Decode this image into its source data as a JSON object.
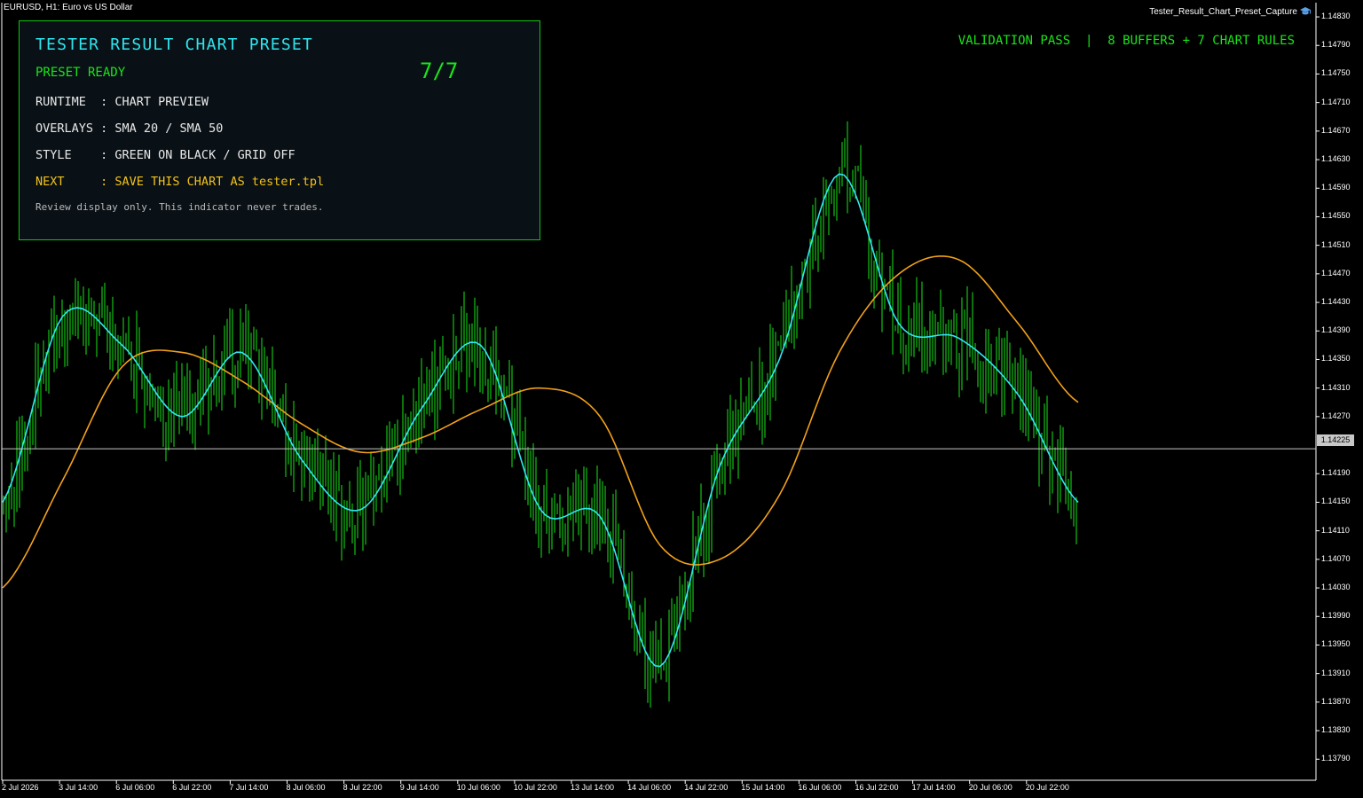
{
  "chart": {
    "title": "EURUSD, H1:  Euro vs US Dollar",
    "window_name": "Tester_Result_Chart_Preset_Capture",
    "hat_icon": "graduation-cap-icon",
    "current_price": "1.14225",
    "price_axis": [
      "1.14830",
      "1.14790",
      "1.14750",
      "1.14710",
      "1.14670",
      "1.14630",
      "1.14590",
      "1.14550",
      "1.14510",
      "1.14470",
      "1.14430",
      "1.14390",
      "1.14350",
      "1.14310",
      "1.14270",
      "1.14190",
      "1.14150",
      "1.14110",
      "1.14070",
      "1.14030",
      "1.13990",
      "1.13950",
      "1.13910",
      "1.13870",
      "1.13830",
      "1.13790"
    ],
    "time_axis": [
      "2 Jul 2026",
      "3 Jul 14:00",
      "6 Jul 06:00",
      "6 Jul 22:00",
      "7 Jul 14:00",
      "8 Jul 06:00",
      "8 Jul 22:00",
      "9 Jul 14:00",
      "10 Jul 06:00",
      "10 Jul 22:00",
      "13 Jul 14:00",
      "14 Jul 06:00",
      "14 Jul 22:00",
      "15 Jul 14:00",
      "16 Jul 06:00",
      "16 Jul 22:00",
      "17 Jul 14:00",
      "20 Jul 06:00",
      "20 Jul 22:00"
    ],
    "colors": {
      "background": "#000000",
      "candles": "#19e619",
      "sma_fast": "#33e6f2",
      "sma_slow": "#f2a11a",
      "bid_line": "#c8c8c8"
    }
  },
  "panel": {
    "title": "TESTER RESULT CHART PRESET",
    "status": "PRESET READY",
    "count": "7/7",
    "rows": [
      {
        "text": "RUNTIME  : CHART PREVIEW"
      },
      {
        "text": "OVERLAYS : SMA 20 / SMA 50"
      },
      {
        "text": "STYLE    : GREEN ON BLACK / GRID OFF"
      },
      {
        "text": "NEXT     : SAVE THIS CHART AS tester.tpl"
      }
    ],
    "footnote": "Review display only. This indicator never trades."
  },
  "banner": {
    "text": "VALIDATION PASS  |  8 BUFFERS + 7 CHART RULES"
  },
  "chart_data": {
    "type": "line",
    "xlabel": "",
    "ylabel": "",
    "ylim": [
      1.1376,
      1.1484
    ],
    "grid": false,
    "current_price": 1.14225,
    "x": [
      "2 Jul 2026",
      "3 Jul 14:00",
      "6 Jul 06:00",
      "6 Jul 22:00",
      "7 Jul 14:00",
      "8 Jul 06:00",
      "8 Jul 22:00",
      "9 Jul 14:00",
      "10 Jul 06:00",
      "10 Jul 22:00",
      "13 Jul 14:00",
      "14 Jul 06:00",
      "14 Jul 22:00",
      "15 Jul 14:00",
      "16 Jul 06:00",
      "16 Jul 22:00",
      "17 Jul 14:00",
      "20 Jul 06:00",
      "20 Jul 22:00"
    ],
    "series": [
      {
        "values": [
          1.1415,
          1.1441,
          1.1437,
          1.1427,
          1.1436,
          1.1421,
          1.1414,
          1.1428,
          1.1437,
          1.1414,
          1.1413,
          1.1392,
          1.142,
          1.1435,
          1.1461,
          1.144,
          1.1438,
          1.143,
          1.1415
        ]
      },
      {
        "values": [
          1.1403,
          1.1418,
          1.1434,
          1.1436,
          1.1432,
          1.1426,
          1.1422,
          1.1424,
          1.1428,
          1.1431,
          1.1427,
          1.1409,
          1.1407,
          1.1416,
          1.1436,
          1.1447,
          1.1449,
          1.144,
          1.1429
        ]
      }
    ]
  }
}
